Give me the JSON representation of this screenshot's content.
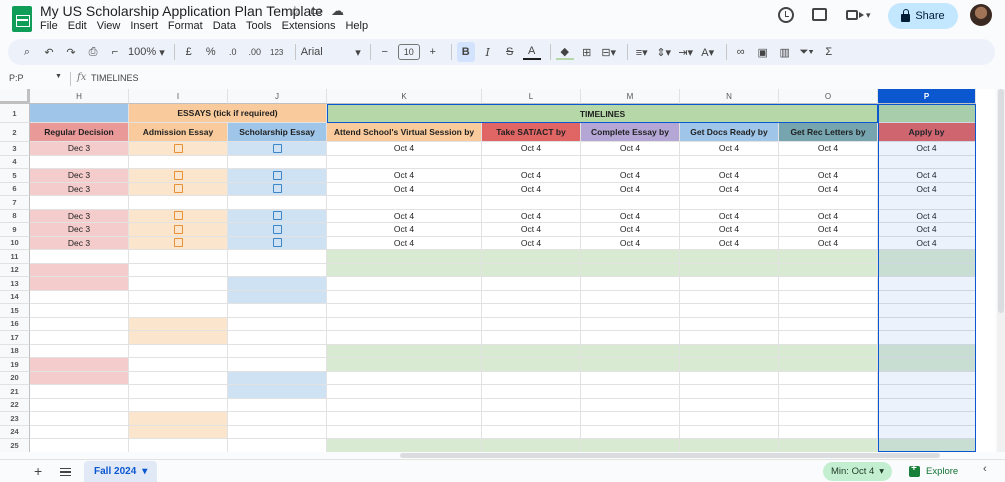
{
  "app": {
    "doc_title": "My US Scholarship Application Plan Template",
    "menu": [
      "File",
      "Edit",
      "View",
      "Insert",
      "Format",
      "Data",
      "Tools",
      "Extensions",
      "Help"
    ],
    "share_label": "Share"
  },
  "toolbar": {
    "zoom": "100%",
    "currency": "£",
    "percent": "%",
    "dec_decrease": ".0",
    "dec_increase": ".00",
    "number_format": "123",
    "font": "Arial",
    "font_size": "10"
  },
  "formula_bar": {
    "name_box": "P:P",
    "fx": "fx",
    "value": "TIMELINES"
  },
  "grid": {
    "columns": [
      "H",
      "I",
      "J",
      "K",
      "L",
      "M",
      "N",
      "O",
      "P"
    ],
    "selected_column": "P",
    "rows": [
      "1",
      "2",
      "3",
      "4",
      "5",
      "6",
      "7",
      "8",
      "9",
      "10",
      "11",
      "12",
      "13",
      "14",
      "15",
      "16",
      "17",
      "18",
      "19",
      "20",
      "21",
      "22",
      "23",
      "24",
      "25"
    ],
    "essays_header": "ESSAYS (tick if required)",
    "timelines_header": "TIMELINES",
    "headers": {
      "H": "Regular Decision",
      "I": "Admission Essay",
      "J": "Scholarship Essay",
      "K": "Attend School's Virtual Session by",
      "L": "Take SAT/ACT by",
      "M": "Complete Essay by",
      "N": "Get Docs Ready by",
      "O": "Get Rec Letters by",
      "P": "Apply by"
    },
    "regular_decision_value": "Dec 3",
    "timeline_value": "Oct 4",
    "data_rows": [
      3,
      5,
      6,
      8,
      9,
      10
    ],
    "colors": {
      "h_light": "#f4cccc",
      "h_header": "#ea9999",
      "h_row1": "#9fc5e8",
      "i_light": "#fce5cd",
      "i_header": "#f9cb9c",
      "i_checkbox": "#e69138",
      "j_light": "#cfe2f3",
      "j_header": "#9fc5e8",
      "j_checkbox": "#3d85c6",
      "k_header": "#f9cb9c",
      "l_header": "#e06666",
      "m_header": "#b4a7d6",
      "n_header": "#9fc5e8",
      "o_header": "#76a5af",
      "p_header": "#e06666",
      "timeline_band": "#b6d7a8",
      "green_light": "#d9ead3"
    }
  },
  "bottom": {
    "sheet_tab": "Fall 2024",
    "stat": "Min: Oct 4",
    "explore": "Explore"
  }
}
